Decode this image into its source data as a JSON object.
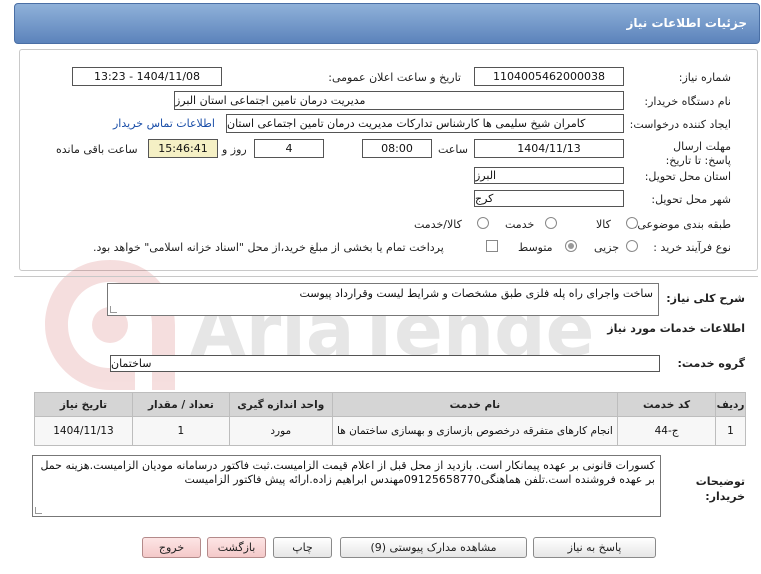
{
  "header": {
    "title": "جزئیات اطلاعات نیاز"
  },
  "fields": {
    "need_number_label": "شماره نیاز:",
    "need_number": "1104005462000038",
    "announce_label": "تاریخ و ساعت اعلان عمومی:",
    "announce_value": "1404/11/08 - 13:23",
    "buyer_label": "نام دستگاه خریدار:",
    "buyer_value": "مدیریت درمان تامین اجتماعی استان البرز",
    "creator_label": "ایجاد کننده درخواست:",
    "creator_value": "کامران شیخ سلیمی ها کارشناس تدارکات مدیریت درمان تامین اجتماعی استان",
    "contact_link": "اطلاعات تماس خریدار",
    "deadline_label": "مهلت ارسال پاسخ: تا تاریخ:",
    "deadline_date": "1404/11/13",
    "time_label": "ساعت",
    "deadline_time": "08:00",
    "days_value": "4",
    "days_label": "روز و",
    "remaining_time": "15:46:41",
    "remaining_label": "ساعت باقی مانده",
    "province_label": "استان محل تحویل:",
    "province_value": "البرز",
    "city_label": "شهر محل تحویل:",
    "city_value": "کرج",
    "category_label": "طبقه بندی موضوعی:",
    "category_options": [
      "کالا",
      "خدمت",
      "کالا/خدمت"
    ],
    "process_label": "نوع فرآیند خرید :",
    "process_options": [
      "جزیی",
      "متوسط"
    ],
    "payment_note": "پرداخت تمام یا بخشی از مبلغ خرید،از محل \"اسناد خزانه اسلامی\" خواهد بود."
  },
  "summary": {
    "label": "شرح کلی نیاز:",
    "value": "ساخت واجرای راه پله فلزی طبق مشخصات و شرایط لیست وقرارداد پیوست"
  },
  "services_section": {
    "title": "اطلاعات خدمات مورد نیاز",
    "group_label": "گروه خدمت:",
    "group_value": "ساختمان"
  },
  "table": {
    "headers": [
      "ردیف",
      "کد خدمت",
      "نام خدمت",
      "واحد اندازه گیری",
      "تعداد / مقدار",
      "تاریخ نیاز"
    ],
    "rows": [
      [
        "1",
        "ج-44",
        "انجام کارهای متفرقه درخصوص بازسازی و بهسازی ساختمان ها",
        "مورد",
        "1",
        "1404/11/13"
      ]
    ]
  },
  "buyer_notes": {
    "label": "توضیحات خریدار:",
    "value": "کسورات قانونی بر عهده پیمانکار است. بازدید از محل قبل از اعلام قیمت الزامیست.ثبت فاکتور درسامانه مودیان الزامیست.هزینه حمل بر عهده فروشنده است.تلفن هماهنگی09125658770مهندس ابراهیم زاده.ارائه پیش فاکتور الزامیست"
  },
  "buttons": {
    "reply": "پاسخ به نیاز",
    "view_docs": "مشاهده مدارک پیوستی (9)",
    "print": "چاپ",
    "back": "بازگشت",
    "exit": "خروج"
  },
  "watermark": "AriaTender.net"
}
